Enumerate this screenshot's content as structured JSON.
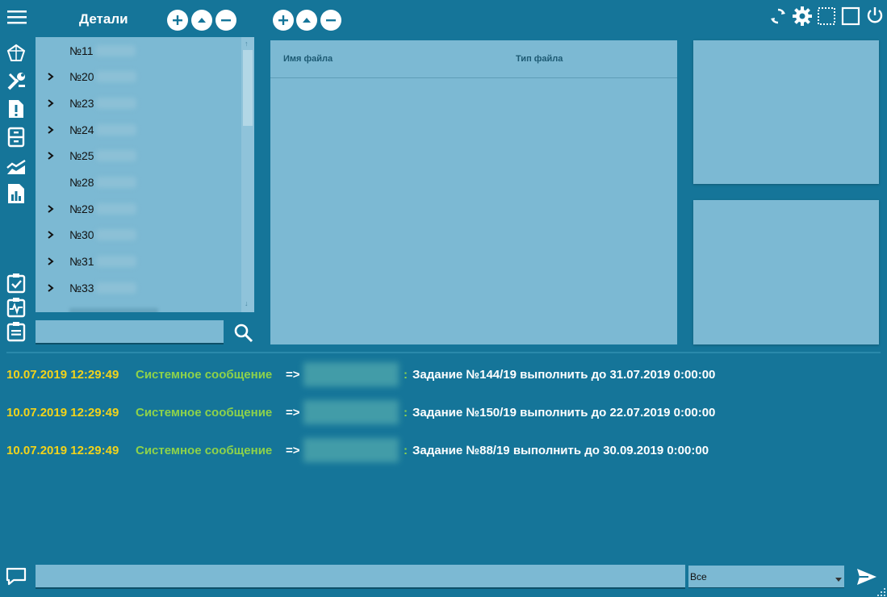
{
  "header": {
    "details_title": "Детали"
  },
  "tree": {
    "items": [
      {
        "label": "№11",
        "expandable": false
      },
      {
        "label": "№20",
        "expandable": true
      },
      {
        "label": "№23",
        "expandable": true
      },
      {
        "label": "№24",
        "expandable": true
      },
      {
        "label": "№25",
        "expandable": true
      },
      {
        "label": "№28",
        "expandable": false
      },
      {
        "label": "№29",
        "expandable": true
      },
      {
        "label": "№30",
        "expandable": true
      },
      {
        "label": "№31",
        "expandable": true
      },
      {
        "label": "№33",
        "expandable": true
      }
    ],
    "search_value": ""
  },
  "files": {
    "col_name": "Имя файла",
    "col_type": "Тип файла"
  },
  "messages": [
    {
      "timestamp": "10.07.2019 12:29:49",
      "source": "Системное сообщение",
      "arrow": "=>",
      "colon": ":",
      "text": "Задание №144/19 выполнить до 31.07.2019 0:00:00"
    },
    {
      "timestamp": "10.07.2019 12:29:49",
      "source": "Системное сообщение",
      "arrow": "=>",
      "colon": ":",
      "text": "Задание №150/19 выполнить до 22.07.2019 0:00:00"
    },
    {
      "timestamp": "10.07.2019 12:29:49",
      "source": "Системное сообщение",
      "arrow": "=>",
      "colon": ":",
      "text": "Задание №88/19 выполнить до 30.09.2019 0:00:00"
    }
  ],
  "composer": {
    "input_value": "",
    "recipient_selected": "Все"
  },
  "colors": {
    "background": "#157599",
    "panel": "#7cb9d3",
    "timestamp": "#f2d31a",
    "system": "#8ed24a"
  }
}
